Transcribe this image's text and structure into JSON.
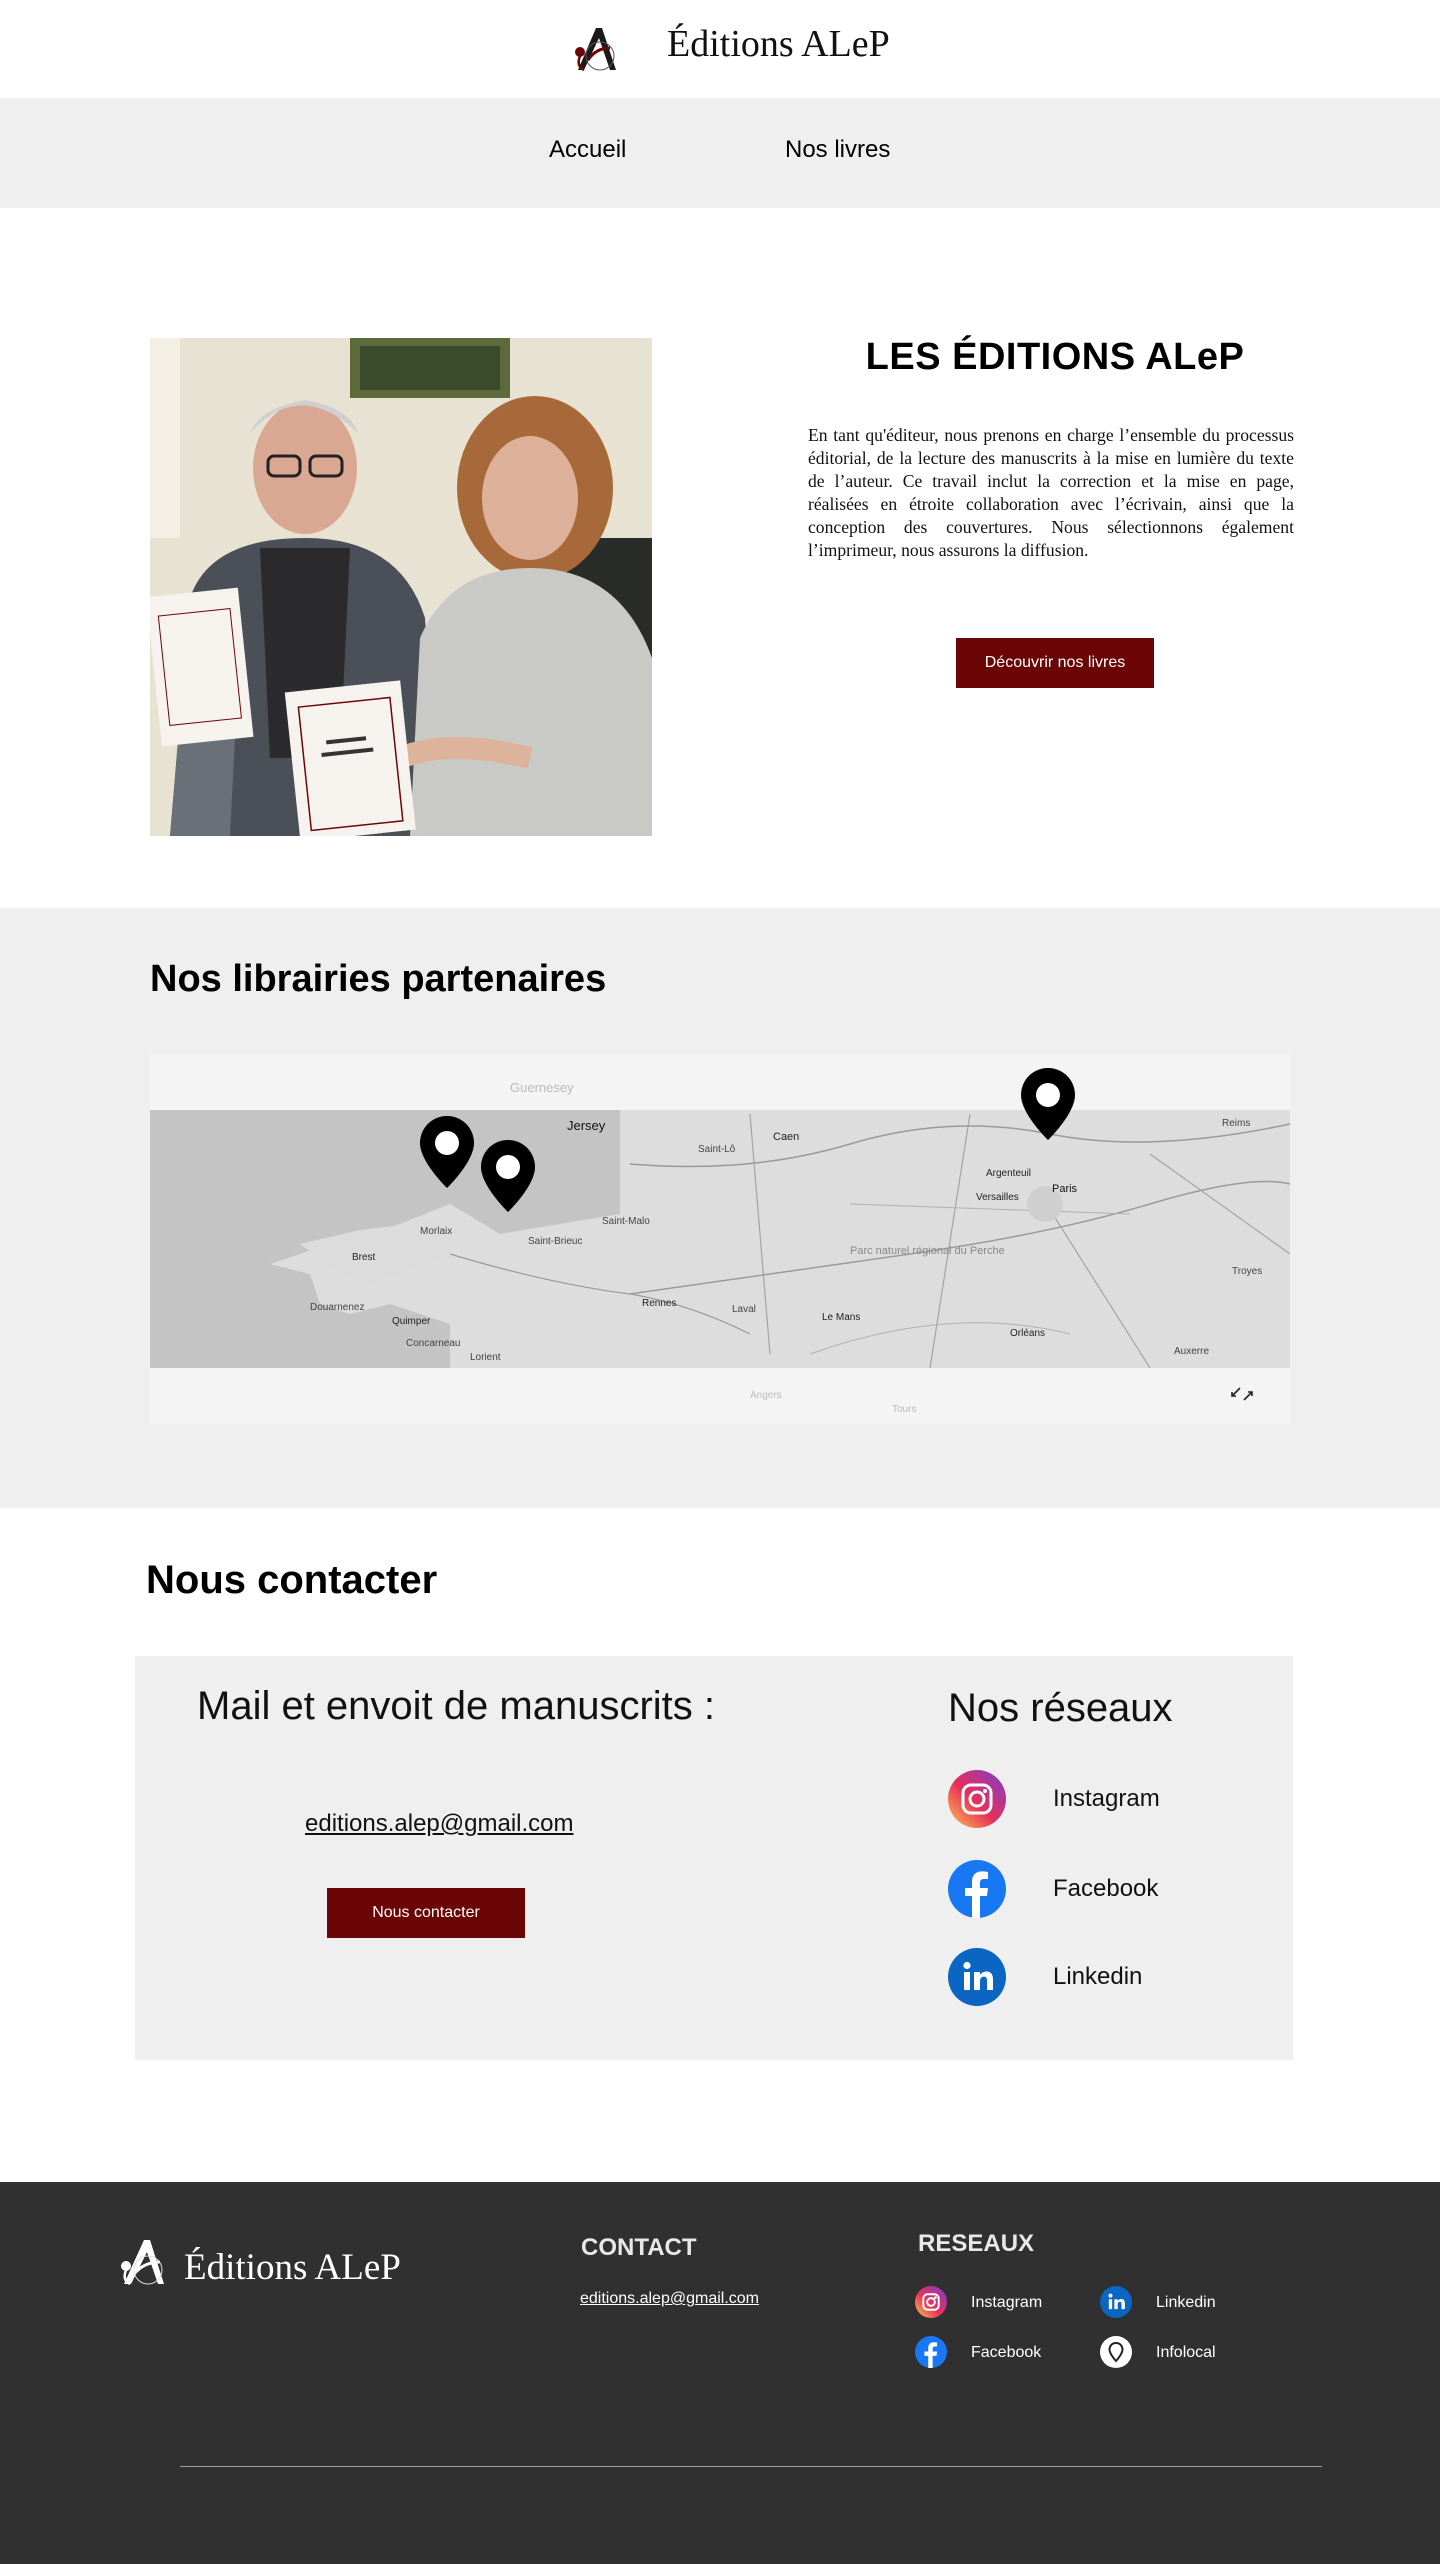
{
  "header": {
    "brand": "Éditions ALeP",
    "logo_icon": "alep-monogram-logo"
  },
  "nav": {
    "items": [
      {
        "label": "Accueil"
      },
      {
        "label": "Nos livres"
      }
    ]
  },
  "hero": {
    "photo_icon": "authors-holding-books-photo",
    "title": "LES ÉDITIONS ALeP",
    "text": "En tant qu'éditeur, nous prenons en charge l’ensemble du processus éditorial, de la lecture des manuscrits à la mise en lumière du texte de l’auteur. Ce travail inclut la correction et la mise en page, réalisées en étroite collaboration avec l’écrivain, ainsi que la conception des couvertures. Nous sélectionnons également l’imprimeur, nous assurons la diffusion.",
    "cta_label": "Découvrir nos livres"
  },
  "partners": {
    "title": "Nos librairies partenaires",
    "map": {
      "places": [
        "Guernesey",
        "Jersey",
        "Caen",
        "Saint-Lô",
        "Argenteuil",
        "Versailles",
        "Paris",
        "Reims",
        "Saint-Malo",
        "Saint-Brieuc",
        "Brest",
        "Morlaix",
        "Douarnenez",
        "Quimper",
        "Concarneau",
        "Lorient",
        "Rennes",
        "Laval",
        "Le Mans",
        "Orléans",
        "Auxerre",
        "Troyes",
        "Angers",
        "Tours",
        "Parc naturel régional du Perche"
      ],
      "pin_icon": "map-pin-icon",
      "expand_icon": "expand-icon"
    }
  },
  "contact": {
    "title": "Nous contacter",
    "mail_heading": "Mail et envoit de manuscrits :",
    "email": "editions.alep@gmail.com",
    "button_label": "Nous contacter",
    "networks_heading": "Nos réseaux",
    "networks": [
      {
        "label": "Instagram",
        "icon": "instagram-icon"
      },
      {
        "label": "Facebook",
        "icon": "facebook-icon"
      },
      {
        "label": "Linkedin",
        "icon": "linkedin-icon"
      }
    ]
  },
  "footer": {
    "brand": "Éditions ALeP",
    "contact_heading": "CONTACT",
    "email": "editions.alep@gmail.com",
    "networks_heading": "RESEAUX",
    "networks": [
      {
        "label": "Instagram",
        "icon": "instagram-icon"
      },
      {
        "label": "Linkedin",
        "icon": "linkedin-icon"
      },
      {
        "label": "Facebook",
        "icon": "facebook-icon"
      },
      {
        "label": "Infolocal",
        "icon": "infolocal-icon"
      }
    ]
  },
  "colors": {
    "accent": "#6a0606",
    "footer_bg": "#303030",
    "section_bg": "#efefef"
  }
}
